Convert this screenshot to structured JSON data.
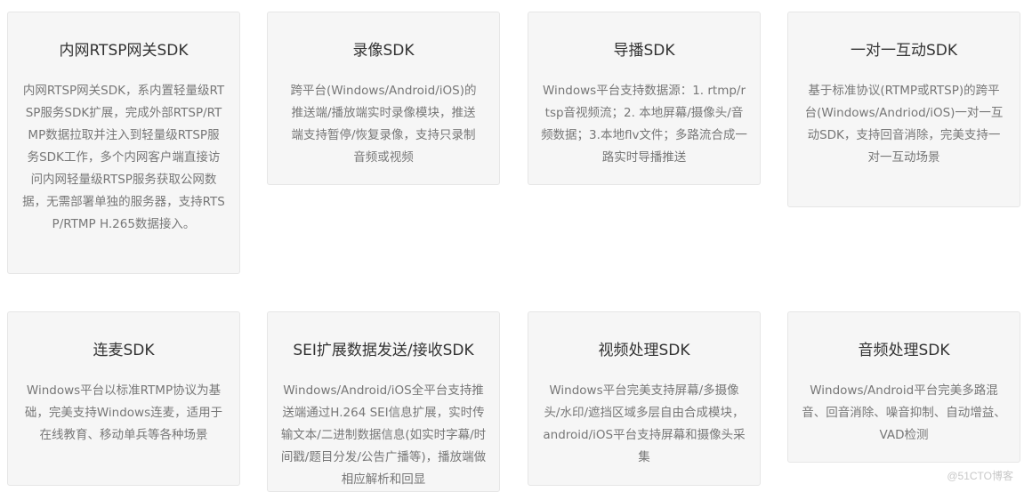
{
  "cards": [
    {
      "title": "内网RTSP网关SDK",
      "description": "内网RTSP网关SDK，系内置轻量级RTSP服务SDK扩展，完成外部RTSP/RTMP数据拉取并注入到轻量级RTSP服务SDK工作，多个内网客户端直接访问内网轻量级RTSP服务获取公网数据，无需部署单独的服务器，支持RTSP/RTMP H.265数据接入。"
    },
    {
      "title": "录像SDK",
      "description": "跨平台(Windows/Android/iOS)的推送端/播放端实时录像模块，推送端支持暂停/恢复录像，支持只录制音频或视频"
    },
    {
      "title": "导播SDK",
      "description": "Windows平台支持数据源：1. rtmp/rtsp音视频流；2. 本地屏幕/摄像头/音频数据；3.本地flv文件；多路流合成一路实时导播推送"
    },
    {
      "title": "一对一互动SDK",
      "description": "基于标准协议(RTMP或RTSP)的跨平台(Windows/Andriod/iOS)一对一互动SDK，支持回音消除，完美支持一对一互动场景"
    },
    {
      "title": "连麦SDK",
      "description": "Windows平台以标准RTMP协议为基础，完美支持Windows连麦，适用于在线教育、移动单兵等各种场景"
    },
    {
      "title": "SEI扩展数据发送/接收SDK",
      "description": "Windows/Android/iOS全平台支持推送端通过H.264 SEI信息扩展，实时传输文本/二进制数据信息(如实时字幕/时间戳/题目分发/公告广播等)，播放端做相应解析和回显"
    },
    {
      "title": "视频处理SDK",
      "description": "Windows平台完美支持屏幕/多摄像头/水印/遮挡区域多层自由合成模块，android/iOS平台支持屏幕和摄像头采集"
    },
    {
      "title": "音频处理SDK",
      "description": "Windows/Android平台完美多路混音、回音消除、噪音抑制、自动增益、VAD检测"
    }
  ],
  "watermark": "@51CTO博客"
}
